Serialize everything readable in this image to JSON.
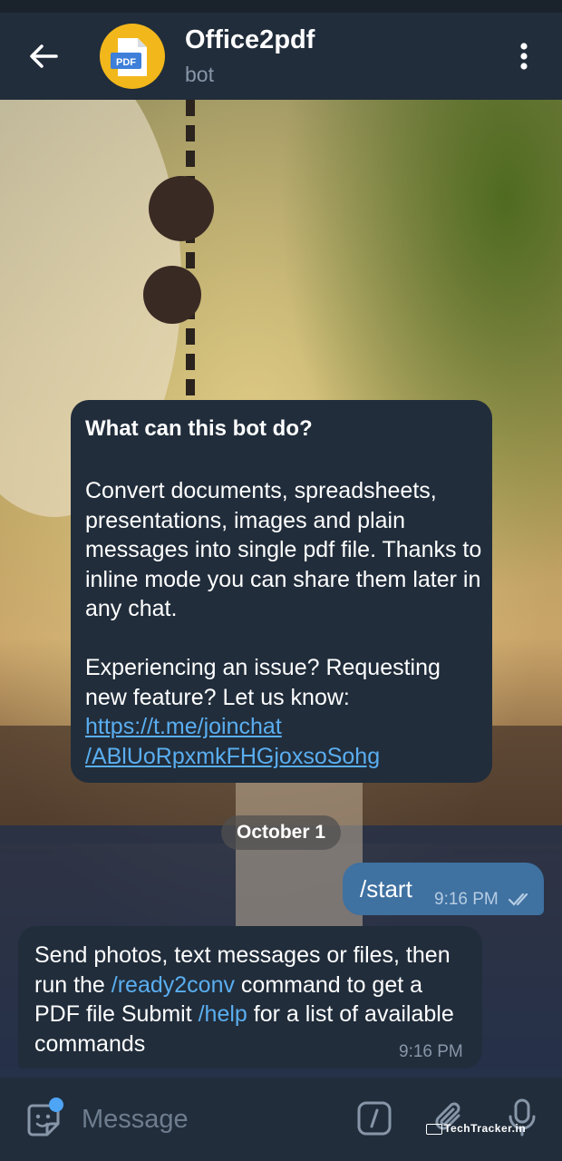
{
  "header": {
    "title": "Office2pdf",
    "subtitle": "bot",
    "avatar_label": "PDF"
  },
  "bot_info": {
    "heading": "What can this bot do?",
    "description": "Convert documents, spreadsheets, presentations, images and plain messages into single pdf file. Thanks to inline mode you can share them later in any chat.",
    "issue_text": "Experiencing an issue? Requesting new feature? Let us know: ",
    "link_line1": "https://t.me/joinchat",
    "link_line2": "/ABlUoRpxmkFHGjoxsoSohg"
  },
  "date_separator": "October 1",
  "messages": [
    {
      "direction": "outgoing",
      "text": "/start",
      "time": "9:16 PM",
      "status": "read"
    },
    {
      "direction": "incoming",
      "part1": "Send photos, text messages or files, then run the ",
      "cmd1": "/ready2conv",
      "part2": " command to get a PDF file Submit ",
      "cmd2": "/help",
      "part3": " for a list of available commands",
      "time": "9:16 PM"
    }
  ],
  "composer": {
    "placeholder": "Message",
    "badge_color": "#4ea4f5"
  },
  "watermark": "TechTracker.in",
  "colors": {
    "header_bg": "#212d3b",
    "incoming_bubble": "#212d3b",
    "outgoing_bubble": "#3f71a1",
    "link": "#5aaef0",
    "avatar_bg": "#f2b71b"
  }
}
